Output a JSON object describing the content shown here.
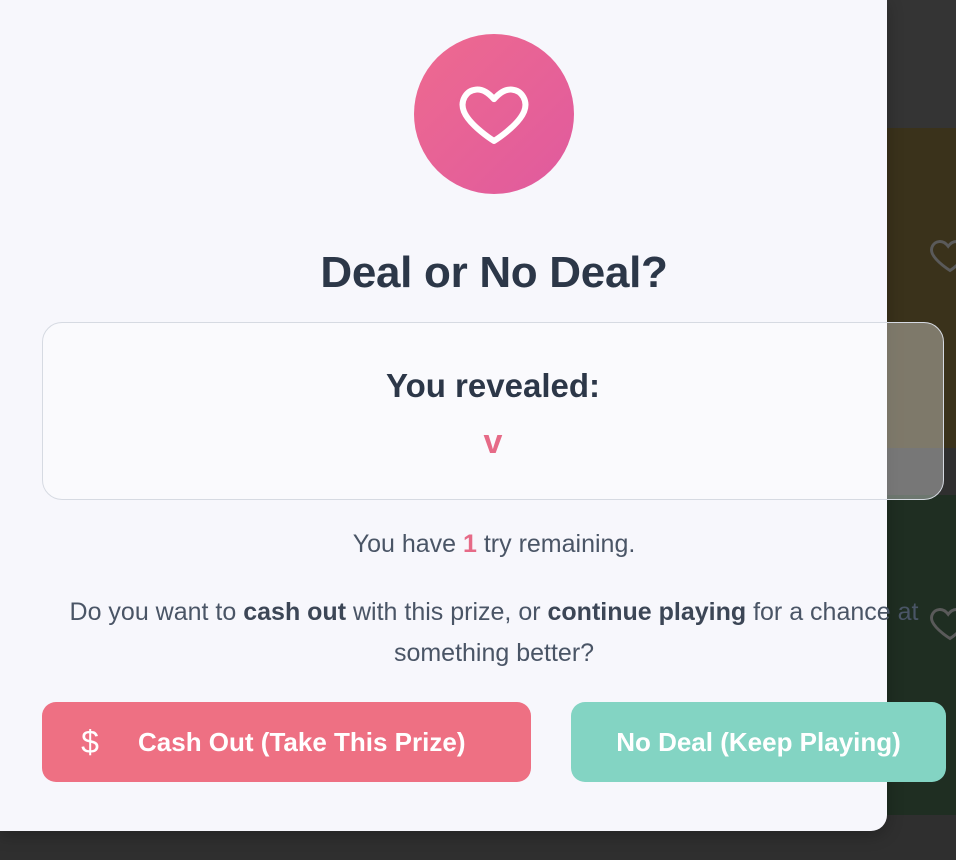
{
  "modal": {
    "title": "Deal or No Deal?",
    "reveal": {
      "label": "You revealed:",
      "value": "v"
    },
    "tries": {
      "prefix": "You have",
      "count": "1",
      "suffix": "try remaining."
    },
    "question": {
      "part1": "Do you want to",
      "bold1": "cash out",
      "part2": "with this prize, or",
      "bold2": "continue playing",
      "part3": "for a chance at something better?"
    },
    "buttons": {
      "cash_out_icon": "$",
      "cash_out_label": "Cash Out (Take This Prize)",
      "no_deal_label": "No Deal (Keep Playing)"
    },
    "icon": "heart-icon"
  },
  "colors": {
    "accent_pink": "#e66a87",
    "cash_button": "#ee7083",
    "no_deal_button": "#83d4c3",
    "title_text": "#2c3748"
  }
}
